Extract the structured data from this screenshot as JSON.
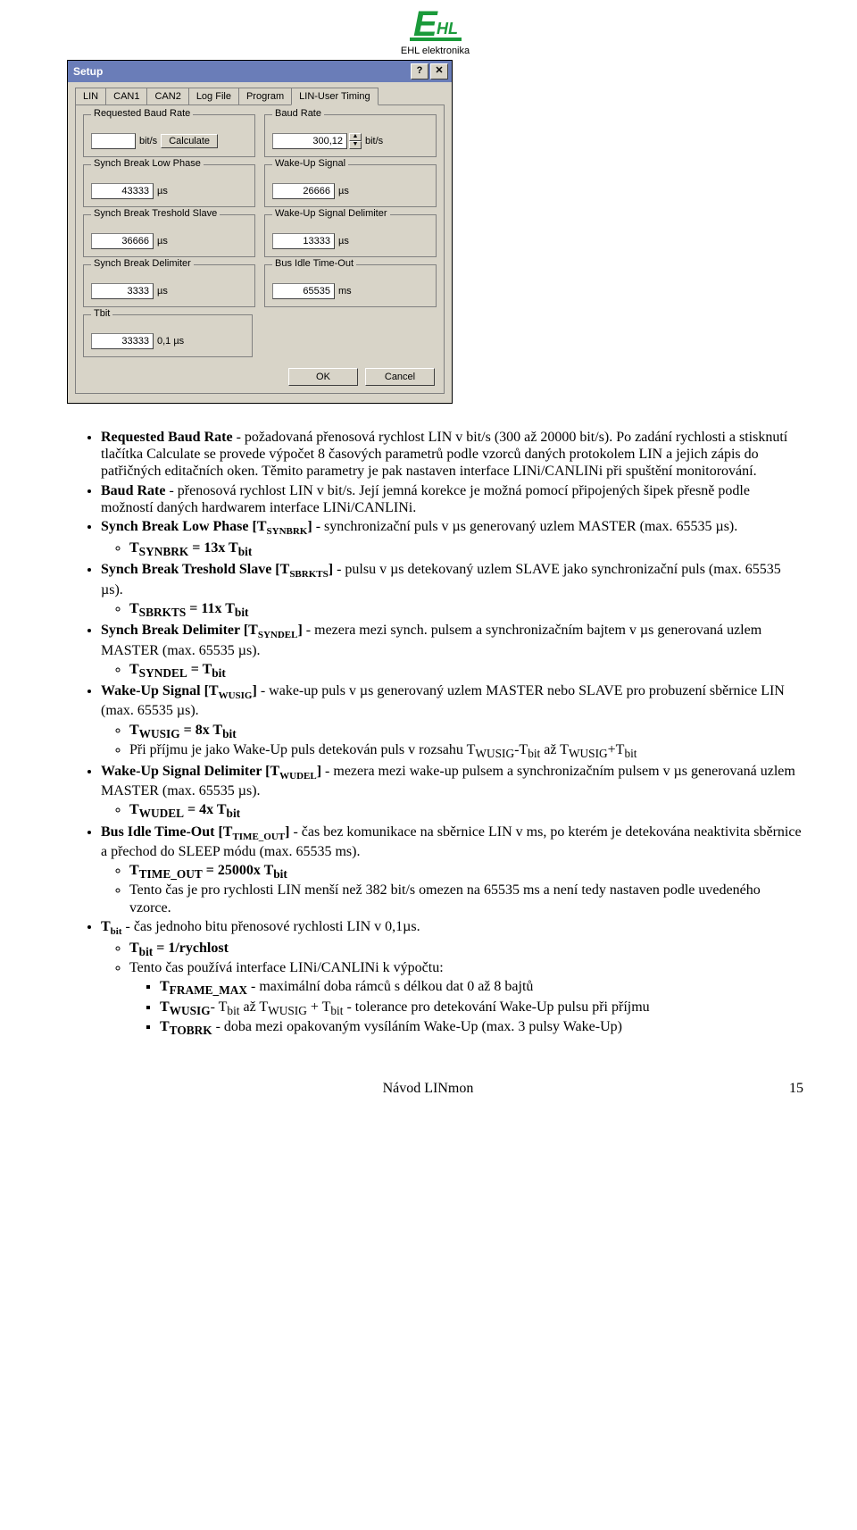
{
  "logo": {
    "letters": "HL",
    "caption": "EHL elektronika"
  },
  "dialog": {
    "title": "Setup",
    "help_glyph": "?",
    "close_glyph": "✕",
    "tabs": [
      "LIN",
      "CAN1",
      "CAN2",
      "Log File",
      "Program",
      "LIN-User Timing"
    ],
    "active_tab": 5,
    "ok": "OK",
    "cancel": "Cancel",
    "groups": {
      "req_baud": {
        "legend": "Requested Baud Rate",
        "value": "",
        "unit": "bit/s",
        "btn": "Calculate"
      },
      "baud_rate": {
        "legend": "Baud Rate",
        "value": "300,12",
        "unit": "bit/s"
      },
      "syn_low": {
        "legend": "Synch Break Low Phase",
        "value": "43333",
        "unit": "µs"
      },
      "wakeup": {
        "legend": "Wake-Up Signal",
        "value": "26666",
        "unit": "µs"
      },
      "tresh": {
        "legend": "Synch Break Treshold Slave",
        "value": "36666",
        "unit": "µs"
      },
      "wu_delim": {
        "legend": "Wake-Up Signal Delimiter",
        "value": "13333",
        "unit": "µs"
      },
      "syn_delim": {
        "legend": "Synch Break Delimiter",
        "value": "3333",
        "unit": "µs"
      },
      "bus_idle": {
        "legend": "Bus Idle Time-Out",
        "value": "65535",
        "unit": "ms"
      },
      "tbit": {
        "legend": "Tbit",
        "value": "33333",
        "unit": "0,1 µs"
      }
    }
  },
  "doc": {
    "items": [
      {
        "lead": "Requested Baud Rate",
        "rest": " - požadovaná přenosová rychlost LIN v bit/s (300 až 20000 bit/s). Po zadání rychlosti a stisknutí tlačítka Calculate se provede výpočet 8 časových parametrů podle vzorců daných protokolem LIN a jejich zápis do patřičných editačních oken. Těmito parametry je pak nastaven interface LINi/CANLINi při spuštění monitorování."
      },
      {
        "lead": "Baud Rate",
        "rest": " - přenosová rychlost LIN v bit/s. Její jemná korekce je možná pomocí připojených šipek přesně podle možností daných hardwarem interface LINi/CANLINi."
      },
      {
        "lead": "Synch Break Low Phase [T",
        "sub": "SYNBRK",
        "after": "]",
        "rest": " - synchronizační puls v µs generovaný uzlem MASTER (max. 65535 µs).",
        "subs": [
          {
            "html": "T<sub>SYNBRK</sub>  = 13x T<sub>bit</sub>"
          }
        ]
      },
      {
        "lead": "Synch Break Treshold Slave [T",
        "sub": "SBRKTS",
        "after": "]",
        "rest": " - pulsu v µs detekovaný uzlem SLAVE jako synchronizační puls (max. 65535 µs).",
        "subs": [
          {
            "html": "T<sub>SBRKTS</sub> = 11x T<sub>bit</sub>"
          }
        ]
      },
      {
        "lead": "Synch Break Delimiter [T",
        "sub": "SYNDEL",
        "after": "]",
        "rest": " - mezera mezi synch. pulsem a synchronizačním bajtem v µs generovaná uzlem MASTER (max. 65535 µs).",
        "subs": [
          {
            "html": "T<sub>SYNDEL</sub> = T<sub>bit</sub>"
          }
        ]
      },
      {
        "lead": "Wake-Up Signal [T",
        "sub": "WUSIG",
        "after": "]",
        "rest": " - wake-up puls v µs generovaný uzlem MASTER nebo SLAVE pro probuzení sběrnice LIN (max. 65535 µs).",
        "subs": [
          {
            "html": "T<sub>WUSIG</sub> = 8x T<sub>bit</sub>"
          },
          {
            "html": "Při příjmu je jako Wake-Up puls detekován puls v rozsahu T<sub>WUSIG</sub>-T<sub>bit</sub> až T<sub>WUSIG</sub>+T<sub>bit</sub>"
          }
        ]
      },
      {
        "lead": "Wake-Up Signal Delimiter [T",
        "sub": "WUDEL",
        "after": "]",
        "rest": " - mezera mezi wake-up pulsem a synchronizačním pulsem v µs generovaná uzlem MASTER (max. 65535 µs).",
        "subs": [
          {
            "html": "T<sub>WUDEL</sub> = 4x T<sub>bit</sub>"
          }
        ]
      },
      {
        "lead": "Bus Idle Time-Out [T",
        "sub": "TIME_OUT",
        "after": "]",
        "rest": " - čas bez komunikace na sběrnice LIN v ms, po kterém je detekována neaktivita sběrnice a přechod do SLEEP módu (max. 65535 ms).",
        "subs": [
          {
            "html": "T<sub>TIME_OUT</sub> = 25000x T<sub>bit</sub>"
          },
          {
            "html": "Tento čas je pro rychlosti LIN menší než 382 bit/s omezen na 65535 ms a není tedy nastaven podle uvedeného vzorce."
          }
        ]
      },
      {
        "lead": "T",
        "sub": "bit",
        "after": "",
        "rest": " - čas jednoho bitu přenosové rychlosti LIN v 0,1µs.",
        "subs": [
          {
            "html": "T<sub>bit</sub> = 1/rychlost"
          },
          {
            "html": "Tento čas používá interface LINi/CANLINi k výpočtu:",
            "squares": [
              {
                "html": "T<sub>FRAME_MAX</sub> - maximální doba rámců s délkou dat 0 až 8 bajtů"
              },
              {
                "html": "T<sub>WUSIG</sub>- T<sub>bit</sub> až T<sub>WUSIG</sub> + T<sub>bit</sub>  - tolerance pro detekování Wake-Up pulsu při příjmu"
              },
              {
                "html": "T<sub>TOBRK</sub> - doba mezi opakovaným vysíláním Wake-Up (max. 3 pulsy Wake-Up)"
              }
            ]
          }
        ]
      }
    ],
    "footer_center": "Návod LINmon",
    "footer_page": "15"
  }
}
